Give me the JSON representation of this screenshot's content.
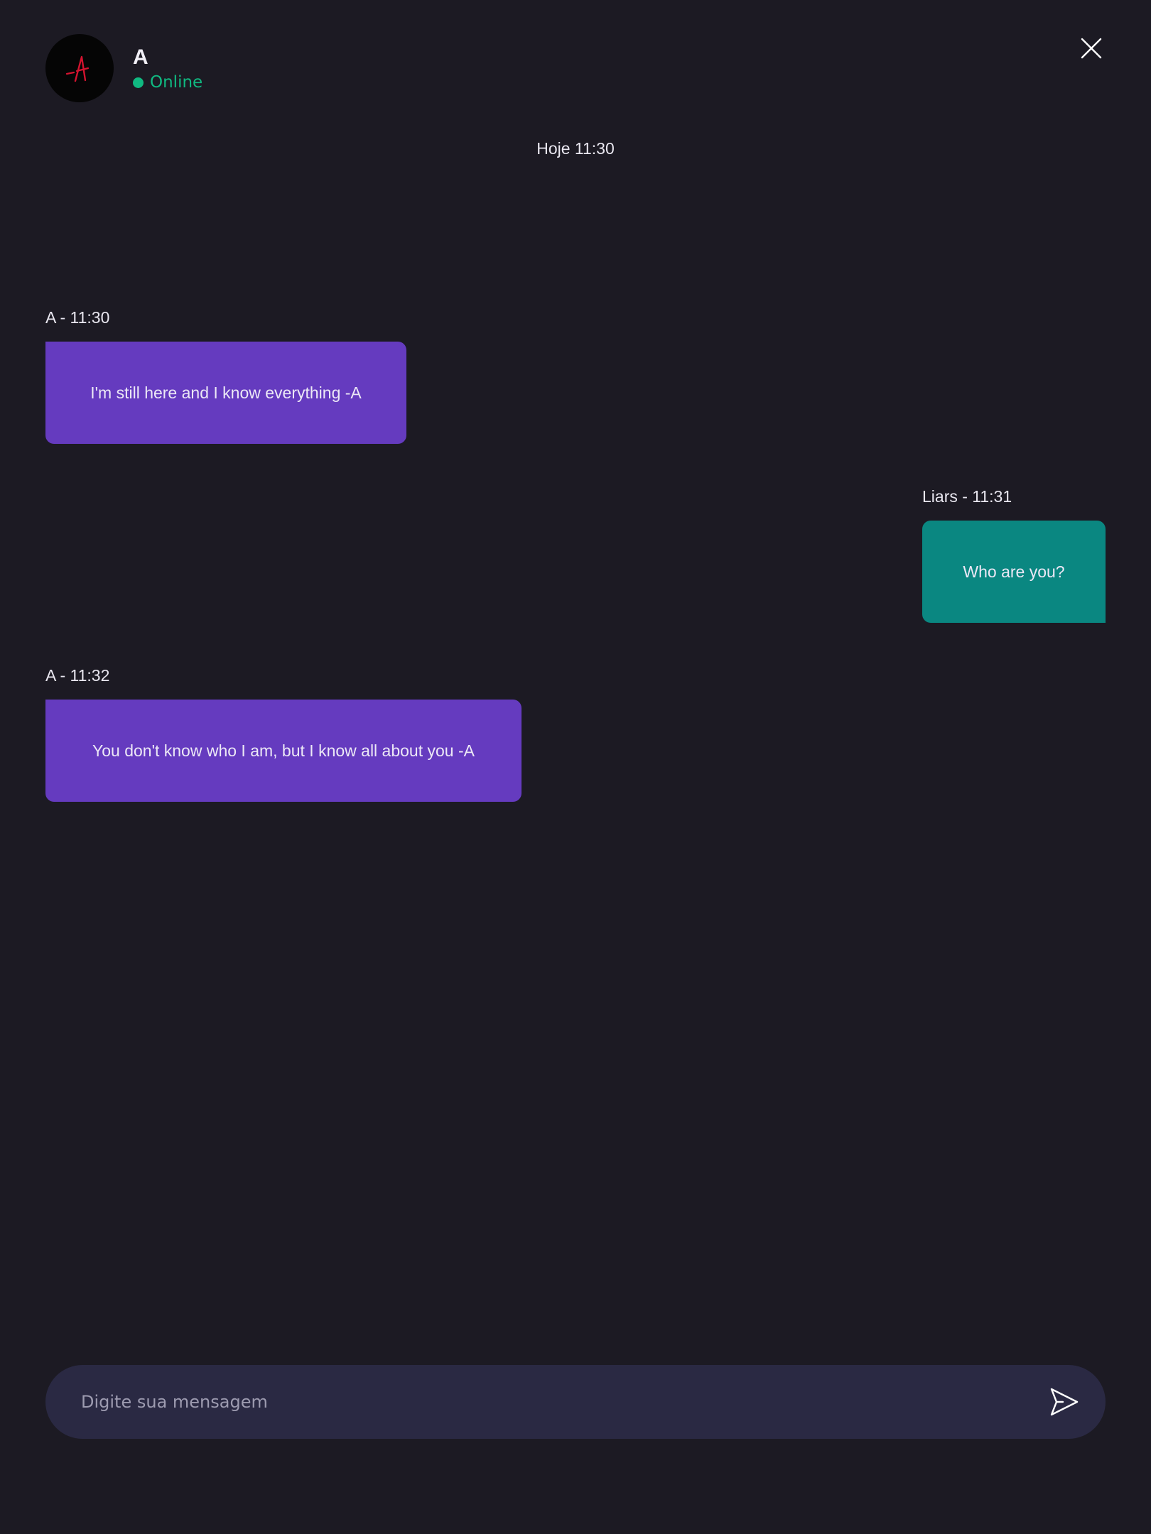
{
  "contact": {
    "name": "A",
    "status": "Online",
    "avatar_icon": "red-a-signature-icon"
  },
  "conversation": {
    "day_separator": "Hoje 11:30",
    "messages": [
      {
        "meta": "A - 11:30",
        "text": "I'm still here and I know everything -A",
        "direction": "incoming"
      },
      {
        "meta": "Liars - 11:31",
        "text": "Who are you?",
        "direction": "outgoing"
      },
      {
        "meta": "A - 11:32",
        "text": "You don't know who I am, but I know all about you -A",
        "direction": "incoming"
      }
    ]
  },
  "composer": {
    "value": "",
    "placeholder": "Digite sua mensagem",
    "send_icon": "send-icon"
  },
  "header": {
    "close_icon": "close-icon"
  },
  "colors": {
    "background": "#1c1a23",
    "incoming_bubble": "#653bbf",
    "outgoing_bubble": "#0a8781",
    "status_online": "#10b981",
    "composer_background": "#2a2943"
  }
}
